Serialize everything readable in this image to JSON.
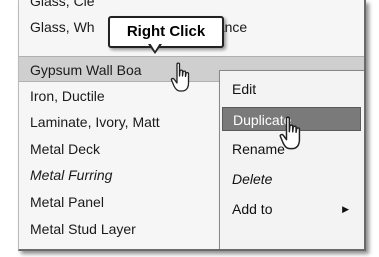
{
  "materials": {
    "items": [
      {
        "label": "Glass, Cle",
        "selected": false,
        "italic": false
      },
      {
        "label": "Glass, Wh",
        "selected": false,
        "italic": false
      },
      {
        "label": "Gypsum Wall Boa",
        "selected": true,
        "italic": false
      },
      {
        "label": "Iron, Ductile",
        "selected": false,
        "italic": false
      },
      {
        "label": "Laminate, Ivory, Matt",
        "selected": false,
        "italic": false
      },
      {
        "label": "Metal Deck",
        "selected": false,
        "italic": false
      },
      {
        "label": "Metal Furring",
        "selected": false,
        "italic": true
      },
      {
        "label": "Metal Panel",
        "selected": false,
        "italic": false
      },
      {
        "label": "Metal Stud Layer",
        "selected": false,
        "italic": false
      }
    ],
    "partial_suffix": "nance"
  },
  "callout": {
    "text": "Right Click"
  },
  "context_menu": {
    "items": [
      {
        "label": "Edit",
        "highlighted": false,
        "italic": false
      },
      {
        "label": "Duplicate",
        "highlighted": true,
        "italic": false
      },
      {
        "label": "Rename",
        "highlighted": false,
        "italic": false
      },
      {
        "label": "Delete",
        "highlighted": false,
        "italic": true
      },
      {
        "label": "Add to",
        "highlighted": false,
        "italic": false,
        "has_submenu": true
      }
    ],
    "submenu_arrow": "▶"
  },
  "icons": {
    "cursor": "hand-pointer-icon"
  }
}
